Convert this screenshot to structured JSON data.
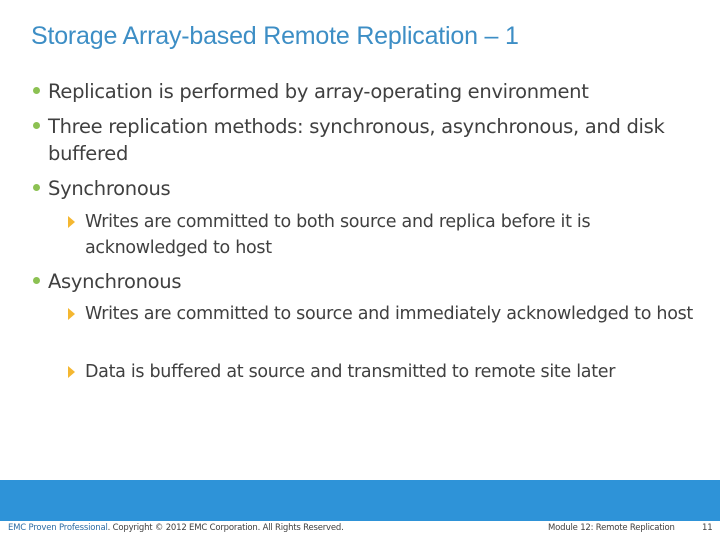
{
  "slide": {
    "title": "Storage Array-based Remote Replication – 1",
    "bullets": [
      {
        "text": "Replication is performed by array-operating environment"
      },
      {
        "text": "Three replication methods: synchronous, asynchronous, and disk buffered"
      },
      {
        "text": "Synchronous",
        "sub": [
          {
            "text": "Writes are committed to both source and replica before it is acknowledged to host"
          }
        ]
      },
      {
        "text": "Asynchronous",
        "sub": [
          {
            "text": "Writes are committed to source and immediately acknowledged to host"
          },
          {
            "text": "Data is buffered at source and transmitted to remote site later"
          }
        ]
      }
    ]
  },
  "footer": {
    "brand": "EMC Proven Professional",
    "copyright": ". Copyright © 2012 EMC Corporation. All Rights Reserved.",
    "module": "Module 12: Remote Replication",
    "page_number": "11"
  },
  "colors": {
    "title": "#3d8ec5",
    "bullet": "#8cc152",
    "sub_bullet": "#f4b731",
    "footer_bar": "#2e93d8"
  }
}
